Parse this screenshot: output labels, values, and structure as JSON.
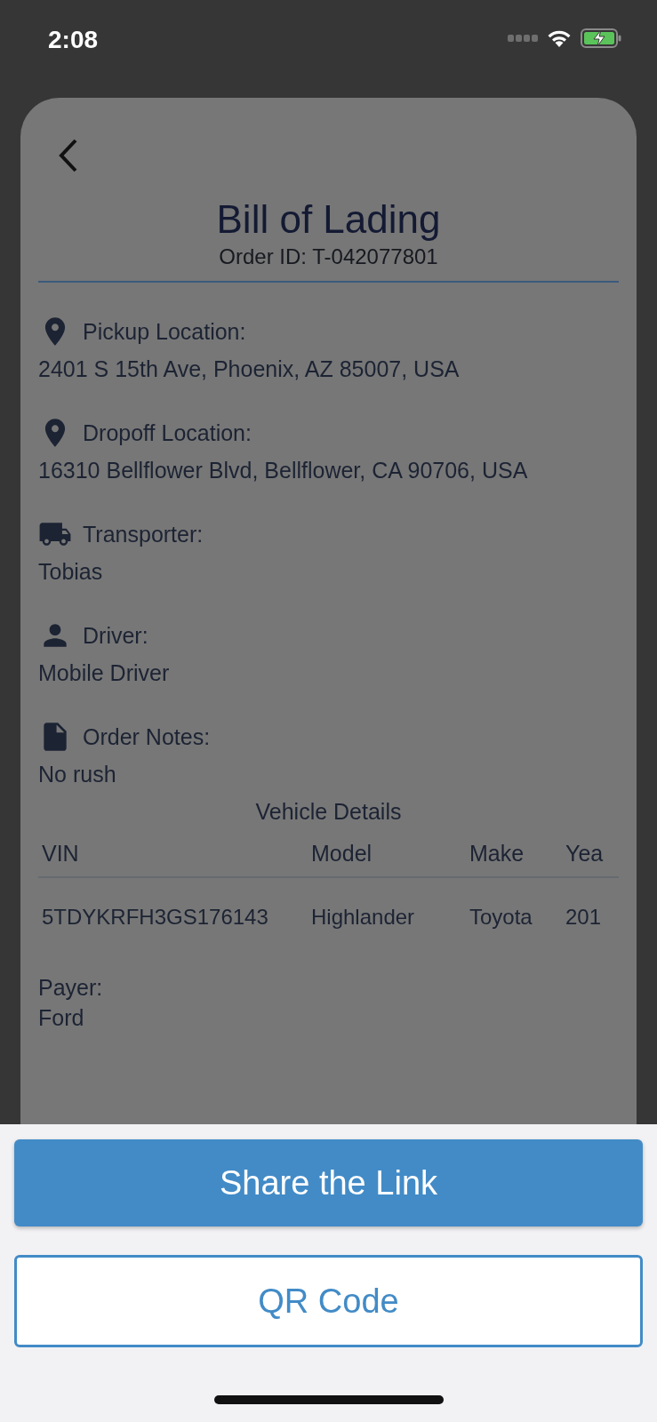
{
  "status_bar": {
    "time": "2:08"
  },
  "header": {
    "title": "Bill of Lading",
    "subtitle": "Order ID: T-042077801"
  },
  "details": [
    {
      "kind": "pin",
      "label": "Pickup Location:",
      "value": "2401 S 15th Ave, Phoenix, AZ 85007, USA"
    },
    {
      "kind": "pin",
      "label": "Dropoff Location:",
      "value": "16310 Bellflower Blvd, Bellflower, CA 90706, USA"
    },
    {
      "kind": "truck",
      "label": "Transporter:",
      "value": "Tobias"
    },
    {
      "kind": "person",
      "label": "Driver:",
      "value": "Mobile Driver"
    },
    {
      "kind": "document",
      "label": "Order Notes:",
      "value": "No rush"
    }
  ],
  "vehicle_details": {
    "title": "Vehicle Details",
    "columns": [
      "VIN",
      "Model",
      "Make",
      "Yea"
    ],
    "rows": [
      [
        "5TDYKRFH3GS176143",
        "Highlander",
        "Toyota",
        "201"
      ]
    ]
  },
  "payer": {
    "label": "Payer:",
    "value": "Ford"
  },
  "buttons": [
    {
      "kind": "primary",
      "label": "Share the Link"
    },
    {
      "kind": "outline",
      "label": "QR Code"
    }
  ]
}
